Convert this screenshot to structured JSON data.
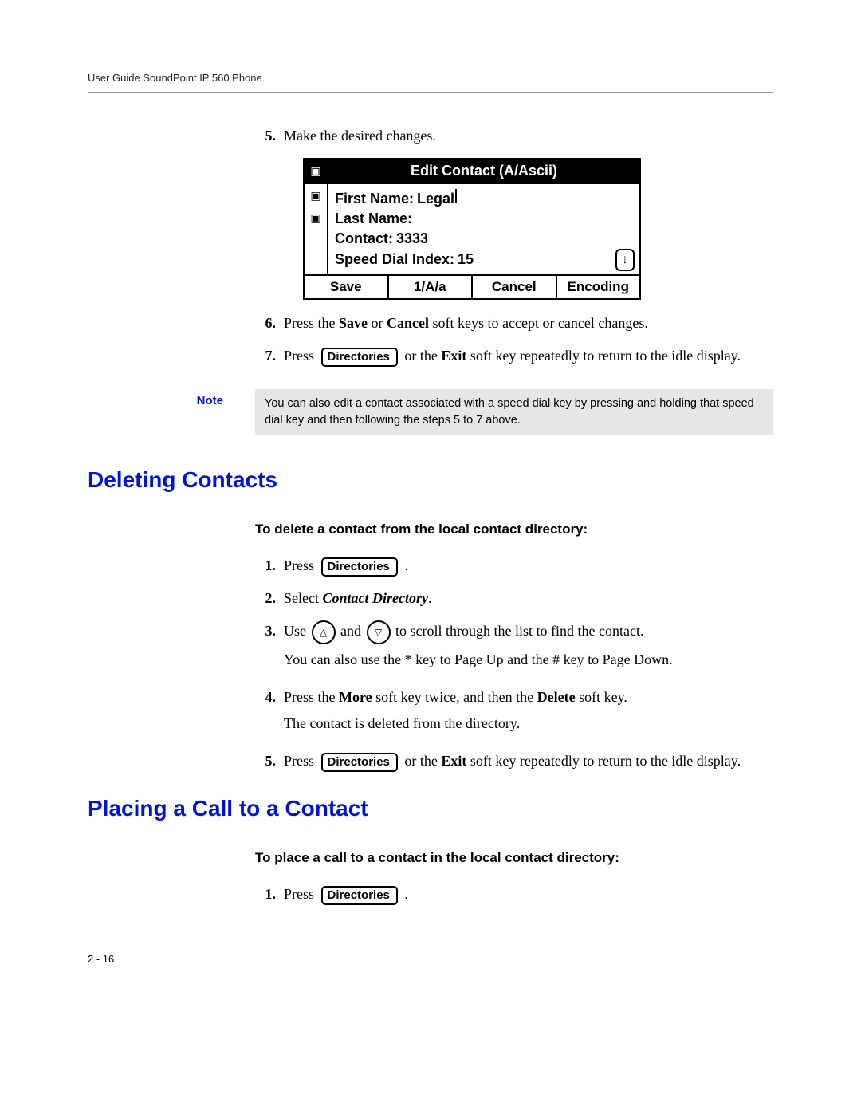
{
  "header": {
    "running": "User Guide SoundPoint IP 560 Phone"
  },
  "editSteps": {
    "s5": {
      "num": "5.",
      "text": "Make the desired changes."
    },
    "s6": {
      "num": "6.",
      "prefix": "Press the ",
      "save": "Save",
      "mid1": " or ",
      "cancel": "Cancel",
      "suffix": " soft keys to accept or cancel changes."
    },
    "s7": {
      "num": "7.",
      "prefix": "Press ",
      "orthe": " or the ",
      "exit": "Exit",
      "suffix": " soft key repeatedly to return to the idle display."
    }
  },
  "phoneScreen": {
    "title": "Edit Contact (A/Ascii)",
    "fields": {
      "firstNameLabel": "First Name:",
      "firstNameValue": "Legal",
      "lastNameLabel": "Last Name:",
      "lastNameValue": "",
      "contactLabel": "Contact:",
      "contactValue": "3333",
      "speedDialLabel": "Speed Dial Index:",
      "speedDialValue": "15"
    },
    "softkeys": {
      "k1": "Save",
      "k2": "1/A/a",
      "k3": "Cancel",
      "k4": "Encoding"
    }
  },
  "keys": {
    "directories": "Directories"
  },
  "note": {
    "label": "Note",
    "text": "You can also edit a contact associated with a speed dial key by pressing and holding that speed dial key and then following the steps 5 to 7 above."
  },
  "deleting": {
    "heading": "Deleting Contacts",
    "subhead": "To delete a contact from the local contact directory:",
    "s1": {
      "num": "1.",
      "prefix": "Press ",
      "suffix": " ."
    },
    "s2": {
      "num": "2.",
      "prefix": "Select ",
      "cd": "Contact Directory",
      "suffix": "."
    },
    "s3": {
      "num": "3.",
      "prefix": "Use ",
      "mid": " and ",
      "suffix": " to scroll through the list to find the contact.",
      "line2": "You can also use the * key to Page Up and the # key to Page Down."
    },
    "s4": {
      "num": "4.",
      "prefix": "Press the ",
      "more": "More",
      "mid1": " soft key twice, and then the ",
      "delete": "Delete",
      "suffix": " soft key.",
      "line2": "The contact is deleted from the directory."
    },
    "s5": {
      "num": "5.",
      "prefix": "Press ",
      "orthe": " or the ",
      "exit": "Exit",
      "suffix": " soft key repeatedly to return to the idle display."
    }
  },
  "placing": {
    "heading": "Placing a Call to a Contact",
    "subhead": "To place a call to a contact in the local contact directory:",
    "s1": {
      "num": "1.",
      "prefix": "Press ",
      "suffix": " ."
    }
  },
  "footer": {
    "page": "2 - 16"
  }
}
